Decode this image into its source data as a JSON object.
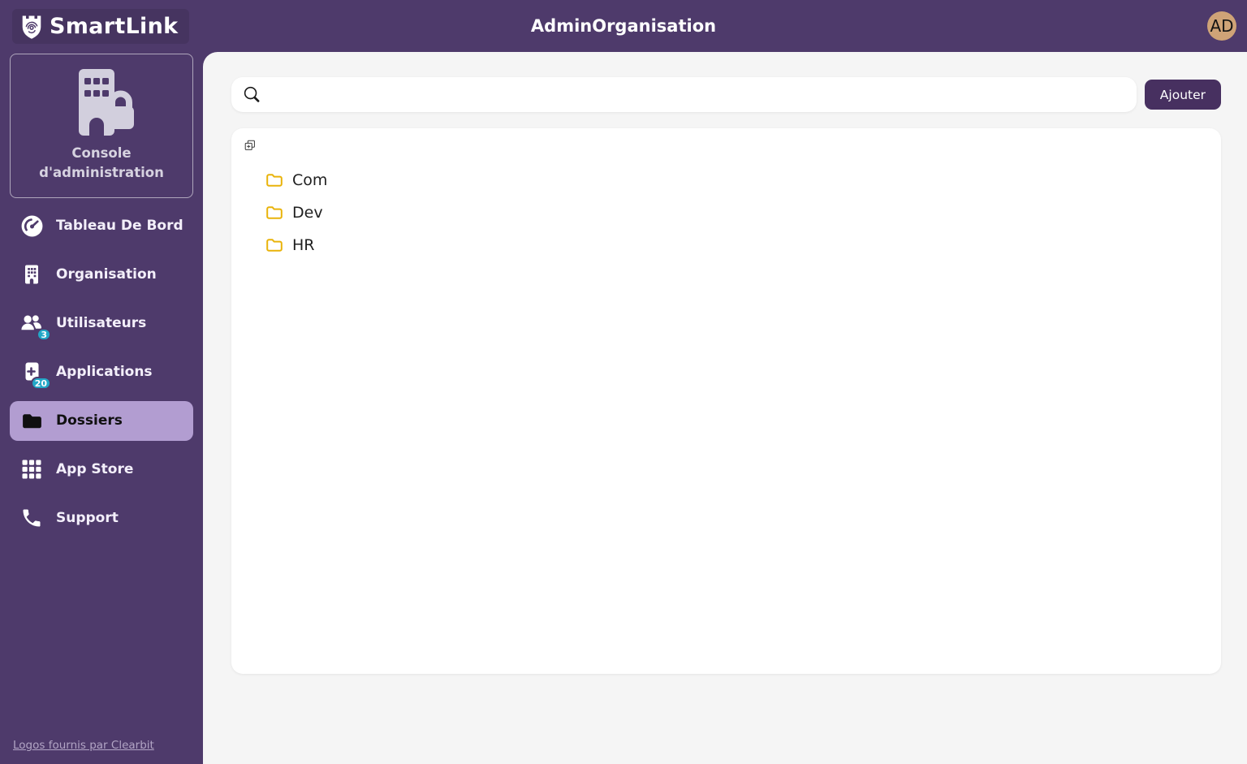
{
  "topbar": {
    "logo_text": "SmartLink",
    "title": "AdminOrganisation",
    "avatar_initials": "AD"
  },
  "sidebar": {
    "console_card": {
      "line1": "Console",
      "line2": "d'administration"
    },
    "items": [
      {
        "label": "Tableau De Bord",
        "icon": "dashboard-icon",
        "badge": null,
        "active": false
      },
      {
        "label": "Organisation",
        "icon": "building-icon",
        "badge": null,
        "active": false
      },
      {
        "label": "Utilisateurs",
        "icon": "users-icon",
        "badge": "3",
        "active": false
      },
      {
        "label": "Applications",
        "icon": "app-plus-icon",
        "badge": "20",
        "active": false
      },
      {
        "label": "Dossiers",
        "icon": "folder-icon",
        "badge": null,
        "active": true
      },
      {
        "label": "App Store",
        "icon": "grid-icon",
        "badge": null,
        "active": false
      },
      {
        "label": "Support",
        "icon": "phone-icon",
        "badge": null,
        "active": false
      }
    ],
    "footer_link": "Logos fournis par Clearbit"
  },
  "main": {
    "search": {
      "value": "",
      "placeholder": ""
    },
    "add_button_label": "Ajouter",
    "tree": {
      "expand_icon": "expand-all-icon",
      "folders": [
        {
          "name": "Com"
        },
        {
          "name": "Dev"
        },
        {
          "name": "HR"
        }
      ]
    }
  },
  "colors": {
    "header_purple": "#4e3a6b",
    "button_purple": "#473060",
    "active_item_bg": "#b29dd1",
    "badge_cyan": "#22a7c7",
    "avatar_tan": "#cfa377",
    "folder_yellow": "#e9b30a",
    "content_bg": "#f5f5f5",
    "card_white": "#ffffff"
  }
}
